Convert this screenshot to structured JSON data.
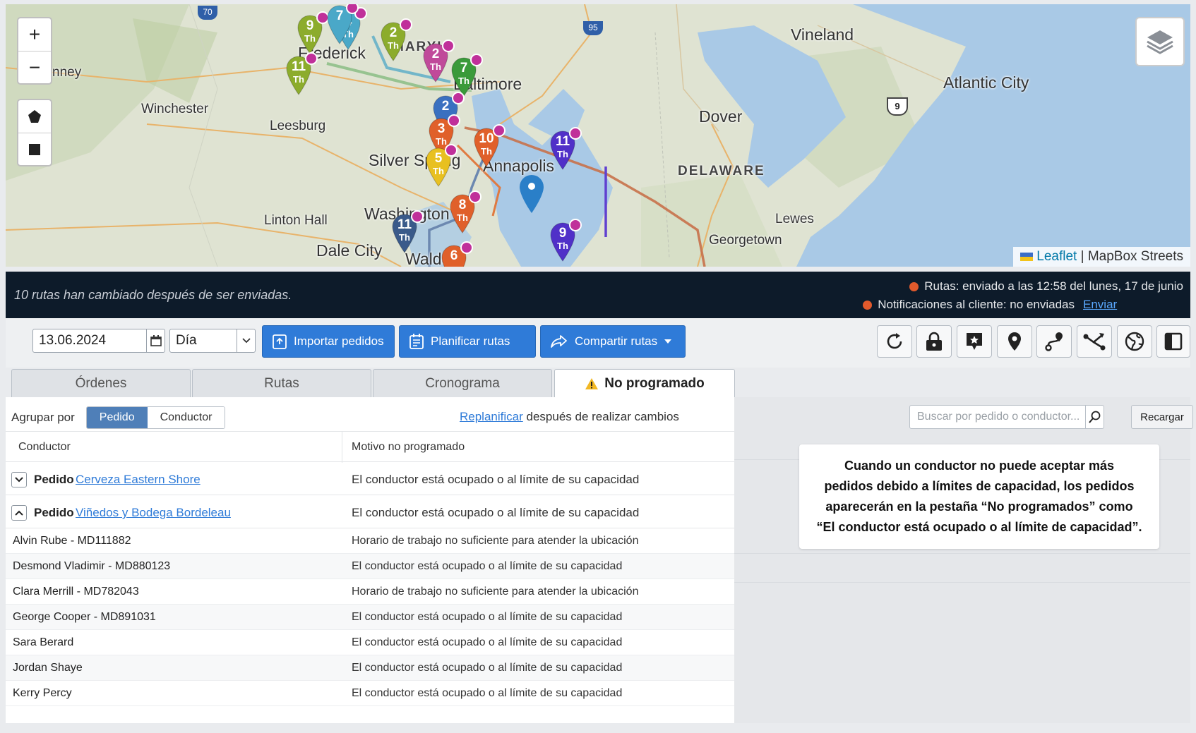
{
  "map": {
    "labels": [
      {
        "id": "vineland",
        "text": "Vineland"
      },
      {
        "id": "atlantic-city",
        "text": "Atlantic City"
      },
      {
        "id": "winchester",
        "text": "Winchester"
      },
      {
        "id": "leesburg",
        "text": "Leesburg"
      },
      {
        "id": "dover",
        "text": "Dover"
      },
      {
        "id": "delaware",
        "text": "DELAWARE"
      },
      {
        "id": "silver-spring",
        "text": "Silver Spring"
      },
      {
        "id": "washington",
        "text": "Washington"
      },
      {
        "id": "linton-hall",
        "text": "Linton Hall"
      },
      {
        "id": "dale-city",
        "text": "Dale City"
      },
      {
        "id": "lewes",
        "text": "Lewes"
      },
      {
        "id": "georgetown",
        "text": "Georgetown"
      },
      {
        "id": "frederick",
        "text": "Frederick"
      },
      {
        "id": "baltimore",
        "text": "Baltimore"
      },
      {
        "id": "annapolis",
        "text": "Annapolis"
      },
      {
        "id": "waldorf",
        "text": "Waldorf"
      },
      {
        "id": "maryland",
        "text": "MARYL"
      },
      {
        "id": "cumberland",
        "text": "nney"
      }
    ],
    "highway_shields": [
      "70",
      "95",
      "9"
    ],
    "pins": [
      {
        "num": "9",
        "day": "Th",
        "color": "#8cac2c"
      },
      {
        "num": "11",
        "day": "Th",
        "color": "#8cac2c"
      },
      {
        "num": "4",
        "day": "Th",
        "color": "#4aa8c8"
      },
      {
        "num": "7",
        "day": "",
        "color": "#4aa8c8"
      },
      {
        "num": "2",
        "day": "Th",
        "color": "#8cac2c"
      },
      {
        "num": "2",
        "day": "Th",
        "color": "#c04a9a"
      },
      {
        "num": "7",
        "day": "Th",
        "color": "#3a9a3a"
      },
      {
        "num": "2",
        "day": "",
        "color": "#3a70c0"
      },
      {
        "num": "3",
        "day": "Th",
        "color": "#e0602a"
      },
      {
        "num": "10",
        "day": "Th",
        "color": "#e0602a"
      },
      {
        "num": "5",
        "day": "Th",
        "color": "#e8c020"
      },
      {
        "num": "11",
        "day": "Th",
        "color": "#5030c8"
      },
      {
        "num": "8",
        "day": "Th",
        "color": "#e0602a"
      },
      {
        "num": "11",
        "day": "Th",
        "color": "#3a5a8a"
      },
      {
        "num": "9",
        "day": "Th",
        "color": "#5030c8"
      },
      {
        "num": "6",
        "day": "",
        "color": "#e0602a"
      }
    ],
    "attribution": {
      "leaflet": "Leaflet",
      "sep": "|",
      "tiles": "MapBox Streets"
    },
    "zoom_in": "+",
    "zoom_out": "−"
  },
  "banner": {
    "message": "10 rutas han cambiado después de ser enviadas.",
    "routes_status": "Rutas: enviado a las 12:58 del lunes, 17 de junio",
    "notif_status": "Notificaciones al cliente: no enviadas",
    "send_link": "Enviar"
  },
  "toolbar": {
    "date": "13.06.2024",
    "period": "Día",
    "import_label": "Importar pedidos",
    "plan_label": "Planificar rutas",
    "share_label": "Compartir rutas"
  },
  "tabs": [
    {
      "label": "Órdenes"
    },
    {
      "label": "Rutas"
    },
    {
      "label": "Cronograma"
    },
    {
      "label": "No programado"
    }
  ],
  "panel": {
    "group_by_label": "Agrupar por",
    "group_options": [
      "Pedido",
      "Conductor"
    ],
    "replan_link": "Replanificar",
    "replan_text": "después de realizar cambios",
    "col_driver": "Conductor",
    "col_reason": "Motivo no programado",
    "groups": [
      {
        "label": "Pedido",
        "name": "Cerveza Eastern Shore",
        "reason": "El conductor está ocupado o al límite de su capacidad"
      },
      {
        "label": "Pedido",
        "name": "Viñedos y Bodega Bordeleau",
        "reason": "El conductor está ocupado o al límite de su capacidad"
      }
    ],
    "rows": [
      {
        "name": "Alvin Rube - MD111882",
        "reason": "Horario de trabajo no suficiente para atender la ubicación"
      },
      {
        "name": "Desmond Vladimir - MD880123",
        "reason": "El conductor está ocupado o al límite de su capacidad"
      },
      {
        "name": "Clara Merrill - MD782043",
        "reason": "Horario de trabajo no suficiente para atender la ubicación"
      },
      {
        "name": "George Cooper - MD891031",
        "reason": "El conductor está ocupado o al límite de su capacidad"
      },
      {
        "name": "Sara Berard",
        "reason": "El conductor está ocupado o al límite de su capacidad"
      },
      {
        "name": "Jordan Shaye",
        "reason": "El conductor está ocupado o al límite de su capacidad"
      },
      {
        "name": "Kerry Percy",
        "reason": "El conductor está ocupado o al límite de su capacidad"
      }
    ]
  },
  "search": {
    "placeholder": "Buscar por pedido o conductor...",
    "reload_label": "Recargar"
  },
  "callout": {
    "lines": [
      "Cuando un conductor no puede aceptar más",
      "pedidos debido a límites de capacidad, los pedidos",
      "aparecerán en la pestaña “No programados” como",
      "“El conductor está ocupado o al límite de capacidad”."
    ]
  },
  "colors": {
    "primary": "#2f7bd8",
    "banner": "#0d1b2a",
    "status_dot": "#e25a2c"
  }
}
